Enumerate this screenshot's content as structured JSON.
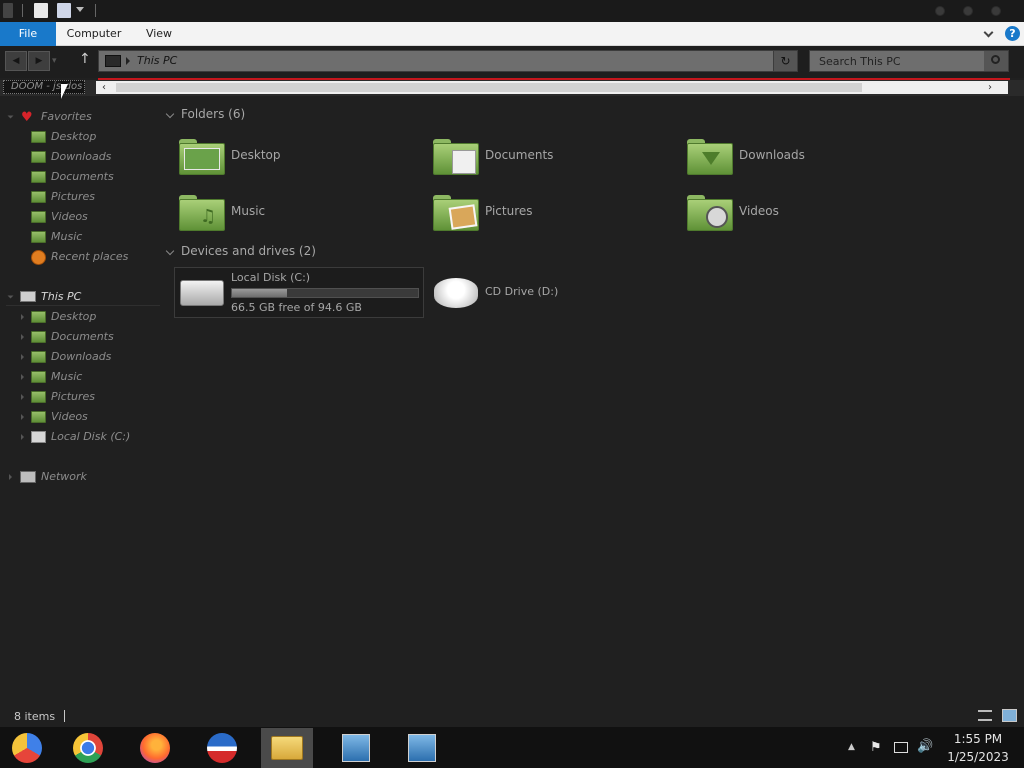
{
  "window": {
    "title": "This PC"
  },
  "ribbon": {
    "tabs": [
      {
        "label": "File"
      },
      {
        "label": "Computer"
      },
      {
        "label": "View"
      }
    ]
  },
  "address": {
    "path": "This PC",
    "search_placeholder": "Search This PC"
  },
  "tabstrip": {
    "tab_label": "DOOM - js-dos"
  },
  "sidebar": {
    "favorites": {
      "label": "Favorites",
      "items": [
        {
          "label": "Desktop"
        },
        {
          "label": "Downloads"
        },
        {
          "label": "Documents"
        },
        {
          "label": "Pictures"
        },
        {
          "label": "Videos"
        },
        {
          "label": "Music"
        },
        {
          "label": "Recent places"
        }
      ]
    },
    "this_pc": {
      "label": "This PC",
      "items": [
        {
          "label": "Desktop"
        },
        {
          "label": "Documents"
        },
        {
          "label": "Downloads"
        },
        {
          "label": "Music"
        },
        {
          "label": "Pictures"
        },
        {
          "label": "Videos"
        },
        {
          "label": "Local Disk (C:)"
        }
      ]
    },
    "network": {
      "label": "Network"
    }
  },
  "content": {
    "folders_header": "Folders (6)",
    "folders": [
      {
        "label": "Desktop",
        "icon": "desktop-folder-icon"
      },
      {
        "label": "Documents",
        "icon": "documents-folder-icon"
      },
      {
        "label": "Downloads",
        "icon": "downloads-folder-icon"
      },
      {
        "label": "Music",
        "icon": "music-folder-icon"
      },
      {
        "label": "Pictures",
        "icon": "pictures-folder-icon"
      },
      {
        "label": "Videos",
        "icon": "videos-folder-icon"
      }
    ],
    "devices_header": "Devices and drives (2)",
    "drives": [
      {
        "label": "Local Disk (C:)",
        "free_text": "66.5 GB free of 94.6 GB",
        "used_fraction": 0.297
      },
      {
        "label": "CD Drive (D:)"
      }
    ]
  },
  "status": {
    "items_count": "8 items"
  },
  "taskbar": {
    "apps": [
      {
        "name": "chromium"
      },
      {
        "name": "chrome"
      },
      {
        "name": "firefox"
      },
      {
        "name": "obama-logo-app"
      },
      {
        "name": "file-explorer"
      },
      {
        "name": "installer-1"
      },
      {
        "name": "installer-2"
      }
    ],
    "time": "1:55 PM",
    "date": "1/25/2023"
  },
  "colors": {
    "accent": "#1979ca",
    "folder_green": "#7fae53",
    "address_red": "#c4161c"
  }
}
